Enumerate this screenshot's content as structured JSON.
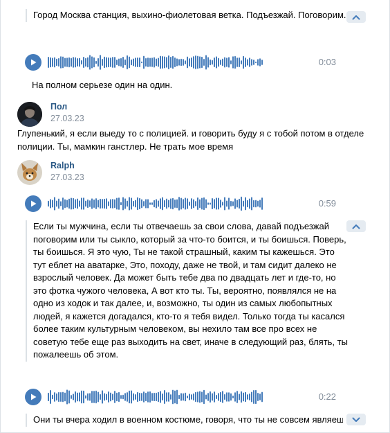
{
  "messages": {
    "m1": {
      "transcript": "Город Москва станция, выхино-фиолетовая ветка. Подъезжай. Поговорим.",
      "collapse_icon": "chevron-up-icon"
    },
    "m2": {
      "duration": "0:03",
      "transcript": "На полном серьезе один на один."
    },
    "m3": {
      "author": "Пол",
      "date": "27.03.23",
      "text": "Глупенький, я если выеду то с полицией. и говорить буду я с тобой потом в отделе полиции. Ты, мамкин ганстлер. Не трать мое время"
    },
    "m4": {
      "author": "Ralph",
      "date": "27.03.23",
      "voice1_duration": "0:59",
      "transcript1": "Если ты мужчина, если ты отвечаешь за свои слова, давай подъезжай поговорим или ты сыкло, который за что-то боится, и ты боишься. Поверь, ты боишься. Я это чую, Ты не такой страшный, каким ты кажешься. Это тут еблет на аватарке, Это, походу, даже не твой, и там сидит далеко не взрослый человек. Да может быть тебе два по двадцать лет и где-то, но это фотка чужого человека, А вот кто ты. Ты, вероятно, появлялся не на одно из ходок и так далее, и, возможно, ты один из самых любопытных людей, я кажется догадался, кто-то я тебя видел. Только тогда ты касался более таким культурным человеком, вы нехило там все про всех не советую тебе еще раз выходить на свет, иначе в следующий раз, блять, ты пожалеешь об этом.",
      "voice2_duration": "0:22",
      "transcript2": "Они ты вчера ходил в военном костюме, говоря, что ты не совсем являешься"
    }
  },
  "icons": {
    "play": "play-icon",
    "expand": "chevron-down-icon",
    "collapse": "chevron-up-icon"
  },
  "colors": {
    "accent": "#447bba",
    "link": "#2a5885",
    "muted": "#818c99",
    "border": "#dce1e6",
    "button_bg": "#e5ebf1"
  }
}
